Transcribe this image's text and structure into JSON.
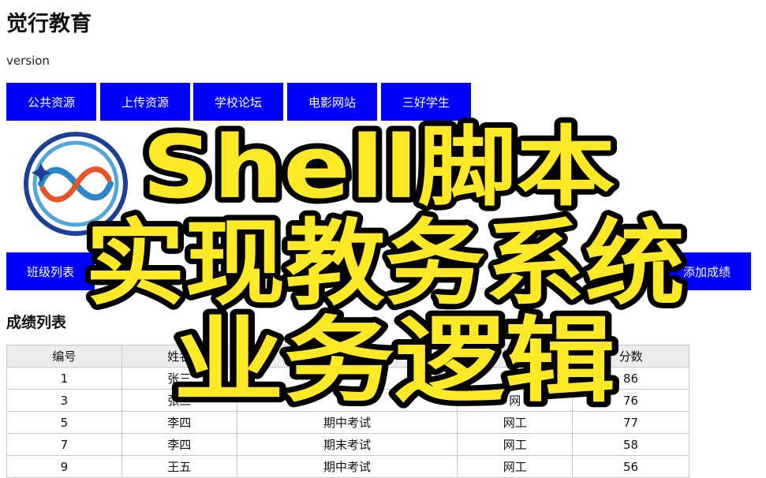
{
  "site": {
    "title": "觉行教育",
    "version": "version"
  },
  "nav": {
    "items": [
      {
        "label": "公共资源"
      },
      {
        "label": "上传资源"
      },
      {
        "label": "学校论坛"
      },
      {
        "label": "电影网站"
      },
      {
        "label": "三好学生"
      }
    ]
  },
  "logo": {
    "icon": "infinity-logo-icon"
  },
  "menu": {
    "items": [
      {
        "label": "班级列表"
      },
      {
        "label": "添加成绩"
      }
    ]
  },
  "section": {
    "title": "成绩列表"
  },
  "table": {
    "headers": [
      "编号",
      "姓名",
      "",
      "",
      "分数"
    ],
    "rows": [
      [
        "1",
        "张三",
        "",
        "",
        "86"
      ],
      [
        "3",
        "张三",
        "",
        "网",
        "76"
      ],
      [
        "5",
        "李四",
        "期中考试",
        "网工",
        "77"
      ],
      [
        "7",
        "李四",
        "期末考试",
        "网工",
        "58"
      ],
      [
        "9",
        "王五",
        "期中考试",
        "网工",
        "56"
      ]
    ]
  },
  "banner": {
    "lines": [
      "Shell脚本",
      "实现教务系统",
      "业务逻辑"
    ],
    "fill_color": "#ffe926",
    "stroke_color": "#000000"
  }
}
